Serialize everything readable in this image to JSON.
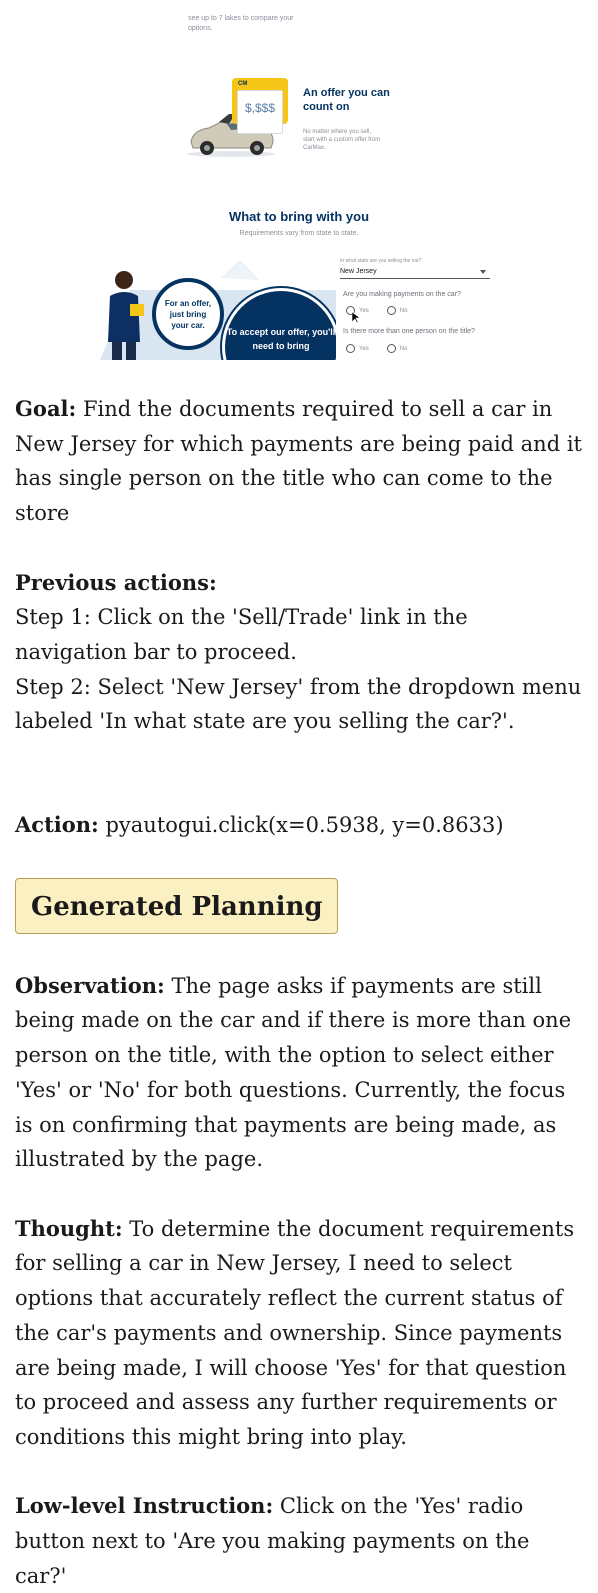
{
  "screenshot": {
    "top_fragment": "see up to 7 lakes to compare your options.",
    "offer": {
      "sign_logo": "CM",
      "price": "$,$$$",
      "title": "An offer you can count on",
      "description": "No matter where you sell, start with a custom offer from CarMax."
    },
    "bring": {
      "title": "What to bring with you",
      "subtitle": "Requirements vary from state to state."
    },
    "illustration": {
      "small_circle_text": "For an offer, just bring your car.",
      "big_circle_text": "To accept our offer, you'll need to bring"
    },
    "form": {
      "state_question": "In what state are you selling the car?",
      "state_value": "New Jersey",
      "payments_question": "Are you making payments on the car?",
      "title_question": "Is there more than one person on the title?",
      "yes_label": "Yes",
      "no_label": "No"
    }
  },
  "goal": {
    "label": "Goal:",
    "text": "Find the documents required to sell a car in New Jersey for which payments are being paid and it has single person on the title who can come to the store"
  },
  "previous_actions": {
    "label": "Previous actions:",
    "steps": [
      "Step 1: Click on the 'Sell/Trade' link in the navigation bar to proceed.",
      "Step 2: Select 'New Jersey' from the dropdown menu labeled 'In what state are you selling the car?'."
    ]
  },
  "action": {
    "label": "Action:",
    "text": "pyautogui.click(x=0.5938, y=0.8633)"
  },
  "planning_header": "Generated Planning",
  "observation": {
    "label": "Observation:",
    "text": "The page asks if payments are still being made on the car and if there is more than one person on the title, with the option to select either 'Yes' or 'No' for both questions. Currently, the focus is on confirming that payments are being made, as illustrated by the page."
  },
  "thought": {
    "label": "Thought:",
    "text": "To determine the document requirements for selling a car in New Jersey, I need to select options that accurately reflect the current status of the car's payments and ownership. Since payments are being made, I will choose 'Yes' for that question to proceed and assess any further requirements or conditions this might bring into play."
  },
  "instruction": {
    "label": "Low-level Instruction:",
    "text": "Click on the 'Yes' radio button next to 'Are you making payments on the car?'"
  }
}
